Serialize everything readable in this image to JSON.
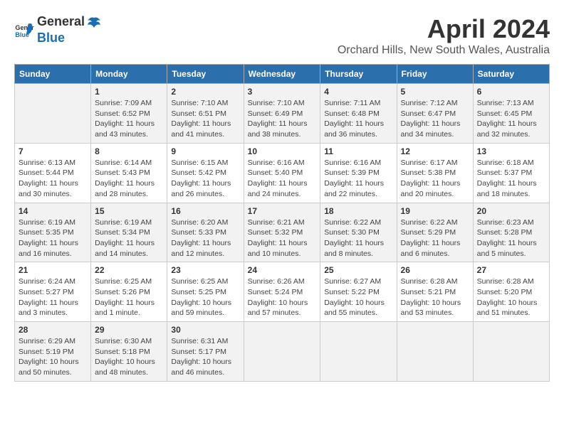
{
  "header": {
    "logo_general": "General",
    "logo_blue": "Blue",
    "month_title": "April 2024",
    "location": "Orchard Hills, New South Wales, Australia"
  },
  "weekdays": [
    "Sunday",
    "Monday",
    "Tuesday",
    "Wednesday",
    "Thursday",
    "Friday",
    "Saturday"
  ],
  "weeks": [
    [
      {
        "day": "",
        "info": ""
      },
      {
        "day": "1",
        "info": "Sunrise: 7:09 AM\nSunset: 6:52 PM\nDaylight: 11 hours\nand 43 minutes."
      },
      {
        "day": "2",
        "info": "Sunrise: 7:10 AM\nSunset: 6:51 PM\nDaylight: 11 hours\nand 41 minutes."
      },
      {
        "day": "3",
        "info": "Sunrise: 7:10 AM\nSunset: 6:49 PM\nDaylight: 11 hours\nand 38 minutes."
      },
      {
        "day": "4",
        "info": "Sunrise: 7:11 AM\nSunset: 6:48 PM\nDaylight: 11 hours\nand 36 minutes."
      },
      {
        "day": "5",
        "info": "Sunrise: 7:12 AM\nSunset: 6:47 PM\nDaylight: 11 hours\nand 34 minutes."
      },
      {
        "day": "6",
        "info": "Sunrise: 7:13 AM\nSunset: 6:45 PM\nDaylight: 11 hours\nand 32 minutes."
      }
    ],
    [
      {
        "day": "7",
        "info": "Sunrise: 6:13 AM\nSunset: 5:44 PM\nDaylight: 11 hours\nand 30 minutes."
      },
      {
        "day": "8",
        "info": "Sunrise: 6:14 AM\nSunset: 5:43 PM\nDaylight: 11 hours\nand 28 minutes."
      },
      {
        "day": "9",
        "info": "Sunrise: 6:15 AM\nSunset: 5:42 PM\nDaylight: 11 hours\nand 26 minutes."
      },
      {
        "day": "10",
        "info": "Sunrise: 6:16 AM\nSunset: 5:40 PM\nDaylight: 11 hours\nand 24 minutes."
      },
      {
        "day": "11",
        "info": "Sunrise: 6:16 AM\nSunset: 5:39 PM\nDaylight: 11 hours\nand 22 minutes."
      },
      {
        "day": "12",
        "info": "Sunrise: 6:17 AM\nSunset: 5:38 PM\nDaylight: 11 hours\nand 20 minutes."
      },
      {
        "day": "13",
        "info": "Sunrise: 6:18 AM\nSunset: 5:37 PM\nDaylight: 11 hours\nand 18 minutes."
      }
    ],
    [
      {
        "day": "14",
        "info": "Sunrise: 6:19 AM\nSunset: 5:35 PM\nDaylight: 11 hours\nand 16 minutes."
      },
      {
        "day": "15",
        "info": "Sunrise: 6:19 AM\nSunset: 5:34 PM\nDaylight: 11 hours\nand 14 minutes."
      },
      {
        "day": "16",
        "info": "Sunrise: 6:20 AM\nSunset: 5:33 PM\nDaylight: 11 hours\nand 12 minutes."
      },
      {
        "day": "17",
        "info": "Sunrise: 6:21 AM\nSunset: 5:32 PM\nDaylight: 11 hours\nand 10 minutes."
      },
      {
        "day": "18",
        "info": "Sunrise: 6:22 AM\nSunset: 5:30 PM\nDaylight: 11 hours\nand 8 minutes."
      },
      {
        "day": "19",
        "info": "Sunrise: 6:22 AM\nSunset: 5:29 PM\nDaylight: 11 hours\nand 6 minutes."
      },
      {
        "day": "20",
        "info": "Sunrise: 6:23 AM\nSunset: 5:28 PM\nDaylight: 11 hours\nand 5 minutes."
      }
    ],
    [
      {
        "day": "21",
        "info": "Sunrise: 6:24 AM\nSunset: 5:27 PM\nDaylight: 11 hours\nand 3 minutes."
      },
      {
        "day": "22",
        "info": "Sunrise: 6:25 AM\nSunset: 5:26 PM\nDaylight: 11 hours\nand 1 minute."
      },
      {
        "day": "23",
        "info": "Sunrise: 6:25 AM\nSunset: 5:25 PM\nDaylight: 10 hours\nand 59 minutes."
      },
      {
        "day": "24",
        "info": "Sunrise: 6:26 AM\nSunset: 5:24 PM\nDaylight: 10 hours\nand 57 minutes."
      },
      {
        "day": "25",
        "info": "Sunrise: 6:27 AM\nSunset: 5:22 PM\nDaylight: 10 hours\nand 55 minutes."
      },
      {
        "day": "26",
        "info": "Sunrise: 6:28 AM\nSunset: 5:21 PM\nDaylight: 10 hours\nand 53 minutes."
      },
      {
        "day": "27",
        "info": "Sunrise: 6:28 AM\nSunset: 5:20 PM\nDaylight: 10 hours\nand 51 minutes."
      }
    ],
    [
      {
        "day": "28",
        "info": "Sunrise: 6:29 AM\nSunset: 5:19 PM\nDaylight: 10 hours\nand 50 minutes."
      },
      {
        "day": "29",
        "info": "Sunrise: 6:30 AM\nSunset: 5:18 PM\nDaylight: 10 hours\nand 48 minutes."
      },
      {
        "day": "30",
        "info": "Sunrise: 6:31 AM\nSunset: 5:17 PM\nDaylight: 10 hours\nand 46 minutes."
      },
      {
        "day": "",
        "info": ""
      },
      {
        "day": "",
        "info": ""
      },
      {
        "day": "",
        "info": ""
      },
      {
        "day": "",
        "info": ""
      }
    ]
  ]
}
